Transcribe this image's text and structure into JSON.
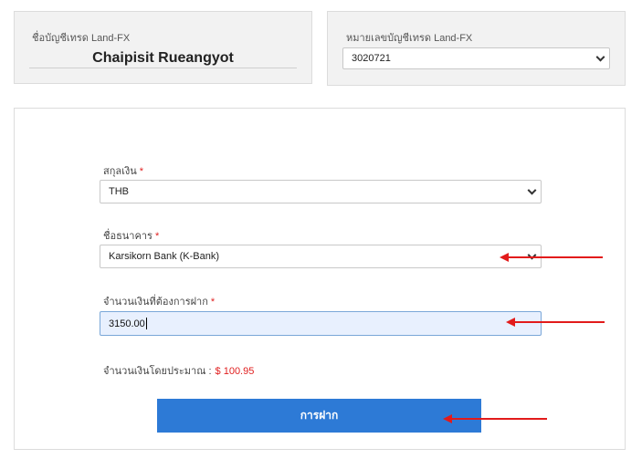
{
  "account_name_panel": {
    "label": "ชื่อบัญชีเทรด Land-FX",
    "value": "Chaipisit Rueangyot"
  },
  "account_number_panel": {
    "label": "หมายเลขบัญชีเทรด Land-FX",
    "selected": "3020721",
    "icon": "chevron-down-icon"
  },
  "form": {
    "currency": {
      "label": "สกุลเงิน",
      "required_mark": "*",
      "selected": "THB"
    },
    "bank": {
      "label": "ชื่อธนาคาร",
      "required_mark": "*",
      "selected": "Karsikorn Bank (K-Bank)"
    },
    "amount": {
      "label": "จำนวนเงินที่ต้องการฝาก",
      "required_mark": "*",
      "value": "3150.00"
    },
    "estimate": {
      "label": "จำนวนเงินโดยประมาณ :",
      "value": "$ 100.95"
    },
    "submit_label": "การฝาก"
  },
  "colors": {
    "accent": "#2d7ad6",
    "required": "#e02020",
    "annotation_arrow": "#e21b1b",
    "input_focus_bg": "#e8f0fe"
  }
}
